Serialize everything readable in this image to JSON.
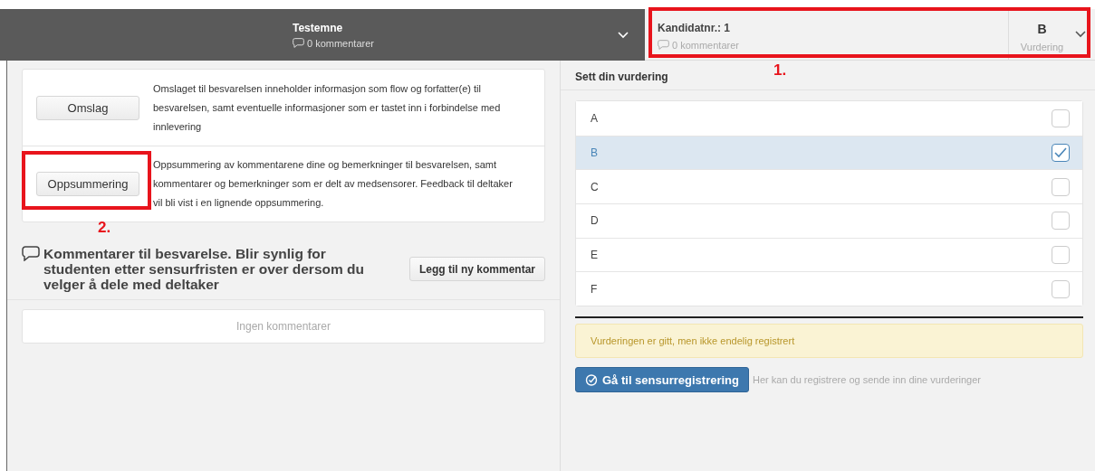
{
  "header": {
    "left": {
      "title": "Testemne",
      "comments": "0 kommentarer"
    },
    "right": {
      "title": "Kandidatnr.: 1",
      "comments": "0 kommentarer",
      "grade": "B",
      "grade_label": "Vurdering",
      "annotation": "1."
    }
  },
  "sections": [
    {
      "button": "Omslag",
      "text": "Omslaget til besvarelsen inneholder informasjon som flow og forfatter(e) til besvarelsen, samt eventuelle informasjoner som er tastet inn i forbindelse med innlevering"
    },
    {
      "button": "Oppsummering",
      "text": "Oppsummering av kommentarene dine og bemerkninger til besvarelsen, samt kommentarer og bemerkninger som er delt av medsensorer. Feedback til deltaker vil bli vist i en lignende oppsummering.",
      "annotation": "2."
    }
  ],
  "comments": {
    "heading": "Kommentarer til besvarelse. Blir synlig for studenten etter sensurfristen er over dersom du velger å dele med deltaker",
    "add_button": "Legg til ny kommentar",
    "empty": "Ingen kommentarer"
  },
  "grading": {
    "title": "Sett din vurdering",
    "options": [
      {
        "label": "A",
        "selected": false
      },
      {
        "label": "B",
        "selected": true
      },
      {
        "label": "C",
        "selected": false
      },
      {
        "label": "D",
        "selected": false
      },
      {
        "label": "E",
        "selected": false
      },
      {
        "label": "F",
        "selected": false
      }
    ]
  },
  "notice": "Vurderingen er gitt, men ikke endelig registrert",
  "register": {
    "button": "Gå til sensurregistrering",
    "hint": "Her kan du registrere og sende inn dine vurderinger"
  }
}
